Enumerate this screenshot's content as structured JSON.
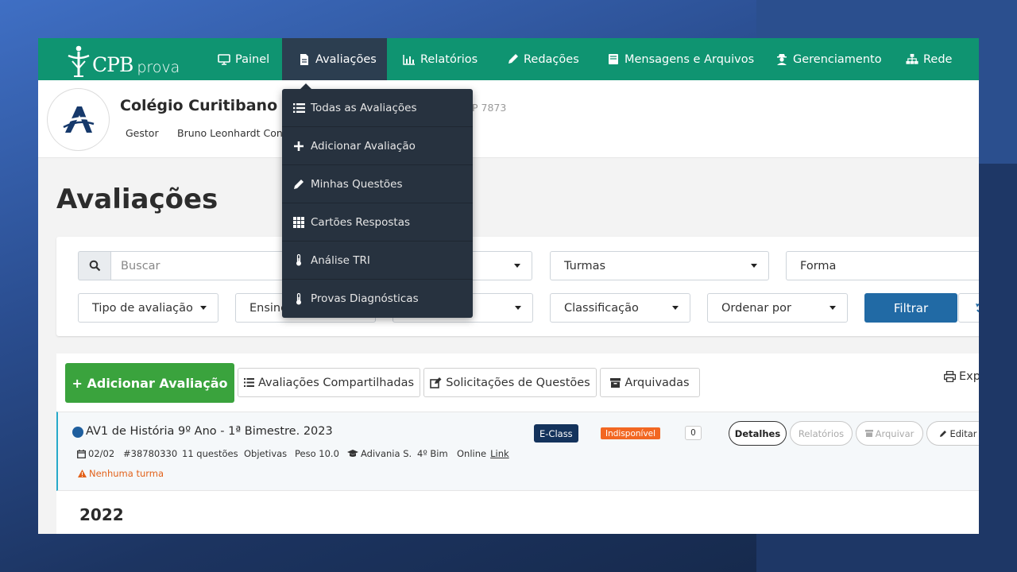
{
  "brand": {
    "logo_cpb": "CPB",
    "logo_prova": "prova"
  },
  "nav": {
    "items": [
      {
        "label": "Painel",
        "icon": "monitor-icon"
      },
      {
        "label": "Avaliações",
        "icon": "file-icon",
        "active": true
      },
      {
        "label": "Relatórios",
        "icon": "bar-chart-icon"
      },
      {
        "label": "Redações",
        "icon": "pencil-icon"
      },
      {
        "label": "Mensagens e Arquivos",
        "icon": "book-icon"
      },
      {
        "label": "Gerenciamento",
        "icon": "user-secret-icon"
      },
      {
        "label": "Rede",
        "icon": "sitemap-icon"
      }
    ]
  },
  "header": {
    "school_name": "Colégio Curitibano Ad",
    "school_code": "P 7873",
    "role": "Gestor",
    "user_name": "Bruno Leonhardt Conce"
  },
  "dropdown": {
    "items": [
      {
        "label": "Todas as Avaliações",
        "icon": "list-icon"
      },
      {
        "label": "Adicionar Avaliação",
        "icon": "plus-icon"
      },
      {
        "label": "Minhas Questões",
        "icon": "pencil-icon"
      },
      {
        "label": "Cartões Respostas",
        "icon": "grid-icon"
      },
      {
        "label": "Análise TRI",
        "icon": "thermometer-icon"
      },
      {
        "label": "Provas Diagnósticas",
        "icon": "thermometer-icon"
      }
    ]
  },
  "page": {
    "title": "Avaliações"
  },
  "filters": {
    "search_placeholder": "Buscar",
    "turmas": "Turmas",
    "forma": "Forma",
    "tipo": "Tipo de avaliação",
    "ensino": "Ensino",
    "classificacao": "Classificação",
    "ordenar": "Ordenar por",
    "filtrar_label": "Filtrar"
  },
  "actions": {
    "add": "+ Adicionar Avaliação",
    "shared": "Avaliações Compartilhadas",
    "requests": "Solicitações de Questões",
    "archived": "Arquivadas",
    "export": "Exp"
  },
  "evaluation": {
    "title": "AV1 de História 9º Ano - 1ª Bimestre. 2023",
    "date": "02/02",
    "id": "#38780330",
    "questions": "11 questões",
    "type": "Objetivas",
    "weight": "Peso 10.0",
    "teacher": "Adivania S.",
    "bimester": "4º Bim",
    "mode": "Online",
    "link": "Link",
    "warning": "Nenhuma turma",
    "badge_class": "E-Class",
    "badge_status": "Indisponível",
    "count": "0",
    "btn_details": "Detalhes",
    "btn_reports": "Relatórios",
    "btn_archive": "Arquivar",
    "btn_edit": "Editar"
  },
  "year_label": "2022",
  "colors": {
    "navbar": "#0f9471",
    "dropdown": "#27323f",
    "primary": "#216aa5",
    "success": "#3aa33d",
    "warning": "#f26722",
    "eclass": "#14335c"
  }
}
